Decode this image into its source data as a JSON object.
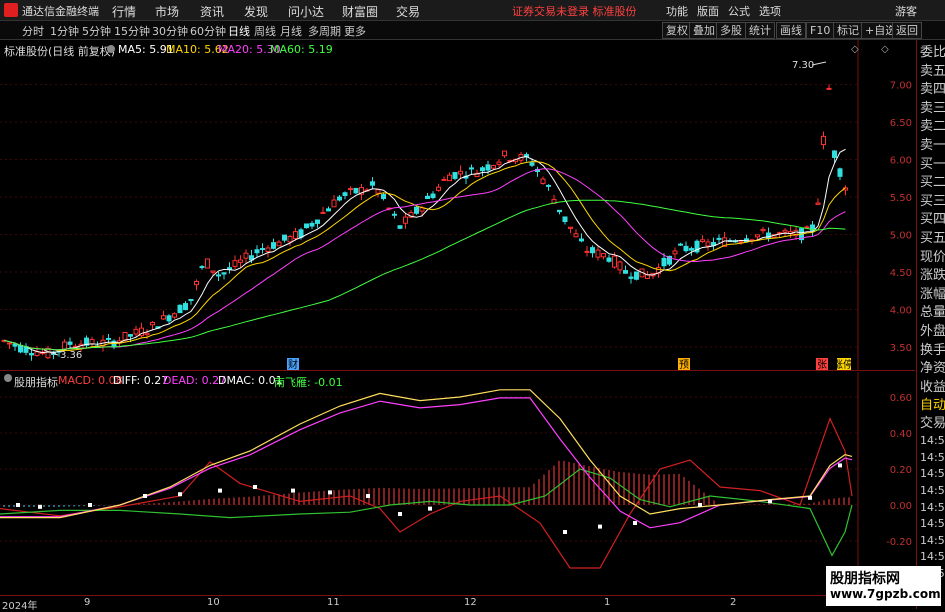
{
  "app": {
    "name": "通达信金融终端",
    "menu": [
      "行情",
      "市场",
      "资讯",
      "发现",
      "问小达",
      "财富圈",
      "交易"
    ],
    "notice": "证券交易未登录  标准股份",
    "right_menu": [
      "功能",
      "版面",
      "公式",
      "选项"
    ],
    "user": "游客"
  },
  "periods": {
    "items": [
      "分时",
      "1分钟",
      "5分钟",
      "15分钟",
      "30分钟",
      "60分钟",
      "日线",
      "周线",
      "月线",
      "多周期",
      "更多"
    ],
    "active": "日线"
  },
  "toolbar": [
    "复权",
    "叠加",
    "多股",
    "统计",
    "画线",
    "F10",
    "标记",
    "+自选",
    "返回"
  ],
  "main": {
    "title": "标准股份(日线 前复权)",
    "ma": [
      {
        "label": "MA5: 5.91",
        "color": "#ffffff"
      },
      {
        "label": "MA10: 5.62",
        "color": "#ffd700"
      },
      {
        "label": "MA20: 5.30",
        "color": "#ff40ff"
      },
      {
        "label": "MA60: 5.19",
        "color": "#40ff40"
      }
    ],
    "high_label": "7.30",
    "low_label": "3.36",
    "yticks": [
      "7.00",
      "6.50",
      "6.00",
      "5.50",
      "5.00",
      "4.50",
      "4.00",
      "3.50"
    ],
    "markers": [
      {
        "text": "财",
        "color": "#4aa3ff"
      },
      {
        "text": "预",
        "color": "#ffb000"
      },
      {
        "text": "张",
        "color": "#ff4040"
      },
      {
        "text": "涨停",
        "color": "#ffd700"
      }
    ]
  },
  "indicator": {
    "name": "股朋指标",
    "legend": [
      {
        "label": "MACD: 0.08",
        "color": "#ff4040"
      },
      {
        "label": "DIFF: 0.27",
        "color": "#ffffff"
      },
      {
        "label": "DEAD: 0.27",
        "color": "#ff40ff"
      },
      {
        "label": "DMAC: 0.01",
        "color": "#ffffff"
      },
      {
        "label": "南飞雁: -0.01",
        "color": "#40ff40"
      }
    ],
    "yticks": [
      "0.60",
      "0.40",
      "0.20",
      "0.00",
      "-0.20"
    ]
  },
  "right_panel": [
    "委比",
    "卖五",
    "卖四",
    "卖三",
    "卖二",
    "卖一",
    "买一",
    "买二",
    "买三",
    "买四",
    "买五",
    "现价",
    "涨跌",
    "涨幅",
    "总量",
    "外盘",
    "换手",
    "净资",
    "收益",
    "自动",
    "交易",
    "14:56",
    "14:56",
    "14:56",
    "14:56",
    "14:56",
    "14:56",
    "14:56",
    "14:56",
    "14:56"
  ],
  "dates": [
    "2024年",
    "9",
    "10",
    "11",
    "12",
    "1",
    "2"
  ],
  "watermark": {
    "line1": "股朋指标网",
    "line2": "www.7gpzb.com"
  }
}
